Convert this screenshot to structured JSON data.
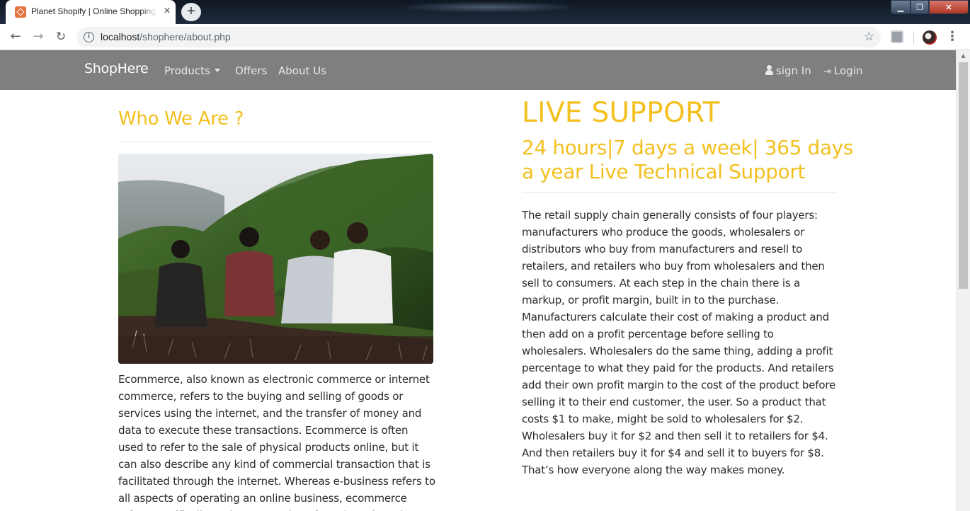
{
  "browser": {
    "tab_title": "Planet Shopify | Online Shopping",
    "tab_close": "×",
    "new_tab": "+",
    "url_host": "localhost",
    "url_path": "/shophere/about.php",
    "window_buttons": {
      "minimize": "▁",
      "maximize": "❐",
      "close": "✕"
    }
  },
  "navbar": {
    "brand": "ShopHere",
    "links": {
      "products": "Products",
      "offers": "Offers",
      "about": "About Us"
    },
    "right": {
      "signin": "sign In",
      "login": "Login"
    }
  },
  "left": {
    "heading": "Who We Are ?",
    "paragraph": "Ecommerce, also known as electronic commerce or internet commerce, refers to the buying and selling of goods or services using the internet, and the transfer of money and data to execute these transactions. Ecommerce is often used to refer to the sale of physical products online, but it can also describe any kind of commercial transaction that is facilitated through the internet. Whereas e-business refers to all aspects of operating an online business, ecommerce refers specifically to the transaction of goods and services."
  },
  "right": {
    "heading": "LIVE SUPPORT",
    "subheading": "24 hours|7 days a week| 365 days a year Live Technical Support",
    "paragraph": "The retail supply chain generally consists of four players: manufacturers who produce the goods, wholesalers or distributors who buy from manufacturers and resell to retailers, and retailers who buy from wholesalers and then sell to consumers. At each step in the chain there is a markup, or profit margin, built in to the purchase. Manufacturers calculate their cost of making a product and then add on a profit percentage before selling to wholesalers. Wholesalers do the same thing, adding a profit percentage to what they paid for the products. And retailers add their own profit margin to the cost of the product before selling it to their end customer, the user. So a product that costs $1 to make, might be sold to wholesalers for $2. Wholesalers buy it for $2 and then sell it to retailers for $4. And then retailers buy it for $4 and sell it to buyers for $8. That’s how everyone along the way makes money."
  },
  "colors": {
    "accent": "#f4c020",
    "navbar_bg": "#7f7f7f",
    "text": "#2b2b2b"
  },
  "icons": [
    "back-icon",
    "forward-icon",
    "reload-icon",
    "info-icon",
    "star-icon",
    "user-icon",
    "login-icon",
    "menu-icon"
  ]
}
